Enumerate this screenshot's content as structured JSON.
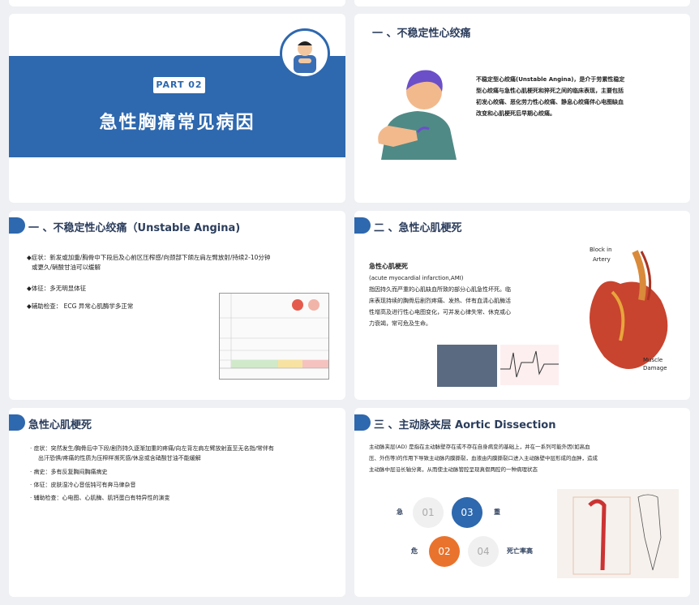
{
  "slide1": {
    "part": "PART   02",
    "title": "急性胸痛常见病因"
  },
  "slide2": {
    "heading": "一 、不稳定性心绞痛",
    "p1": "不稳定型心绞痛(Unstable          Angina)，是介于劳累性稳定",
    "p2": "型心绞痛与急性心肌梗死和猝死之间的临床表现，主要包括",
    "p3": "初发心绞痛、恶化劳力性心绞痛、静息心绞痛伴心电图缺血",
    "p4": "改变和心肌梗死后早期心绞痛。"
  },
  "slide3": {
    "heading": "一 、不稳定性心绞痛（Unstable        Angina)",
    "b1a": "◆症状：新发或加重/胸骨中下段后及心前区压榨感/向颈部下颌左肩左臂放射/持续2-10分钟",
    "b1b": "或更久/硝酸甘油可以缓解",
    "b2": "◆体征：多无明显体征",
    "b3": "◆辅助检查： ECG  异常心肌酶学多正常"
  },
  "slide4": {
    "heading": "二 、急性心肌梗死",
    "sub": "急性心肌梗死",
    "en": "(acute     myocardial     infarction,AMI)",
    "p1": "指因持久而严重的心肌缺血所致的部分心肌急性坏死。临",
    "p2": "床表现持续的胸骨后剧烈疼痛、发热、伴有血清心肌酶活",
    "p3": "性增高及进行性心电图变化，可并发心律失常、休克或心",
    "p4": "力衰竭，常可危及生命。",
    "label_block": "Block   in",
    "label_artery": "Artery",
    "label_muscle": "Muscle",
    "label_damage": "Damage"
  },
  "slide5": {
    "heading": "急性心肌梗死",
    "b1a": "·   症状：突然发生/胸骨后中下段/剧烈持久逐渐加重的疼痛/向左背左肩左臂放射直至无名指/常伴有",
    "b1b": "出汗恐惧/疼痛的性质为压榨样濒死感/休息或含硝酸甘油不能缓解",
    "b2": "·   病史：多有反复胸闷胸痛病史",
    "b3": "·   体征：皮肤湿冷心音低钝可有奔马律杂音",
    "b4": "·   辅助检查：心电图、心肌酶、肌钙蛋白有特异性的演变"
  },
  "slide6": {
    "heading": "三 、主动脉夹层 Aortic   Dissection",
    "p1": "主动脉夹层(AD)     是指在主动脉壁存在或不存在自身病变的基础上，并在一系列可能外因(如高血",
    "p2": "压、外伤等)的作用下导致主动脉内膜撕裂，血液由内膜撕裂口进入主动脉壁中层形成的血肿，造成",
    "p3": "主动脉中层沿长轴分离，从而使主动脉管腔呈现真假两腔的一种病理状态",
    "c1": "01",
    "c2": "02",
    "c3": "03",
    "c4": "04",
    "w1": "急",
    "w2": "危",
    "w3": "重",
    "w4": "死亡率高"
  }
}
